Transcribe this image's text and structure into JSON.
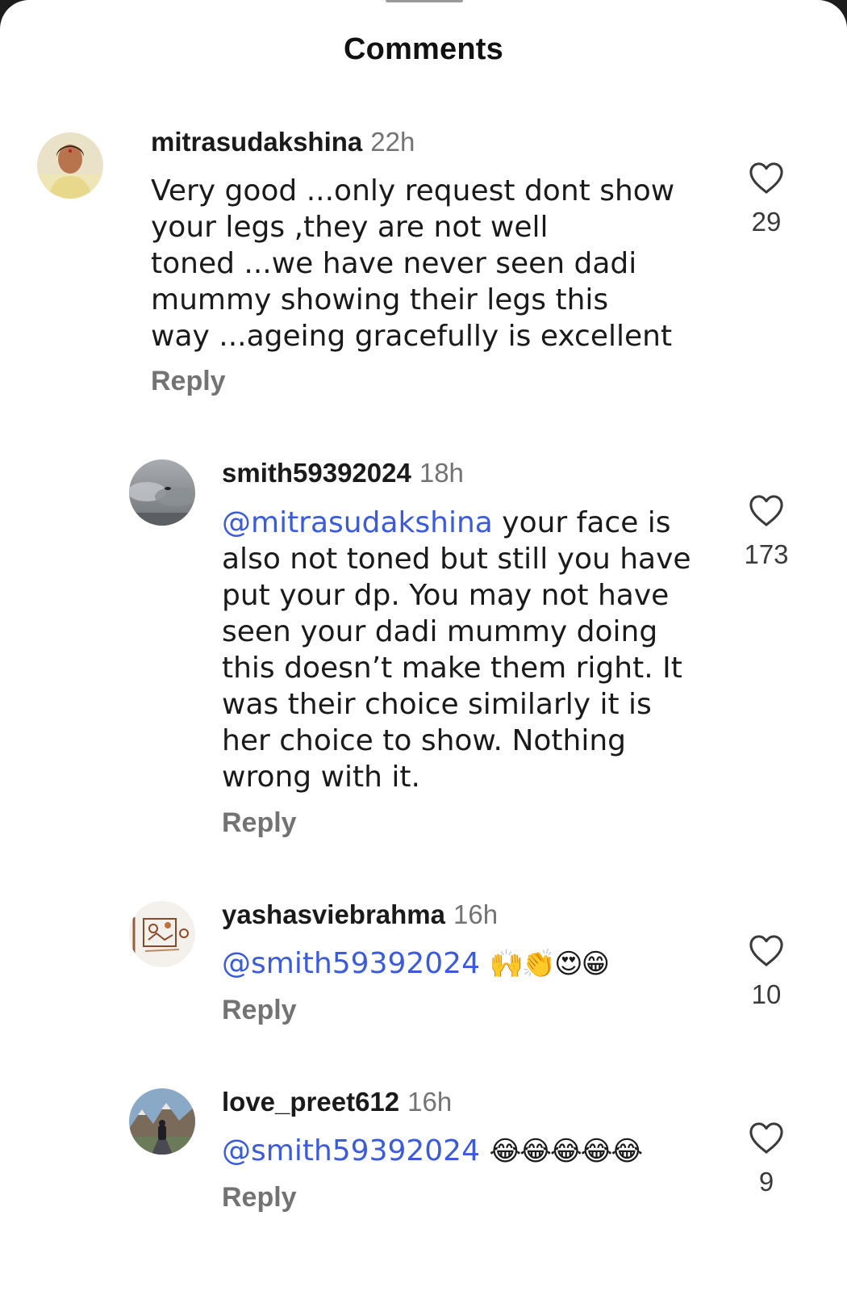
{
  "sheet": {
    "title": "Comments"
  },
  "comments": [
    {
      "username": "mitrasudakshina",
      "time": "22h",
      "text_lines": [
        "Very good ...only request dont show",
        "your legs ,they are not well",
        "toned ...we have never seen dadi",
        "mummy showing their legs this",
        "way ...ageing gracefully  is excellent"
      ],
      "reply_label": "Reply",
      "like_count": "29",
      "avatar_icon": "profile-photo-woman"
    },
    {
      "username": "smith59392024",
      "time": "18h",
      "mention": "@mitrasudakshina",
      "text_first_line_rest": " your face is",
      "text_lines": [
        "also not toned but still you have",
        "put your dp. You may not have",
        "seen your dadi mummy doing",
        "this doesn’t make them right. It",
        "was their choice similarly it is",
        "her choice to show. Nothing",
        "wrong with it."
      ],
      "reply_label": "Reply",
      "like_count": "173",
      "avatar_icon": "profile-photo-cloudy-sky"
    },
    {
      "username": "yashasviebrahma",
      "time": "16h",
      "mention": "@smith59392024",
      "emojis": "🙌👏😍😁",
      "reply_label": "Reply",
      "like_count": "10",
      "avatar_icon": "profile-photo-sketch"
    },
    {
      "username": "love_preet612",
      "time": "16h",
      "mention": "@smith59392024",
      "emojis": "😂😂😂😂😂",
      "reply_label": "Reply",
      "like_count": "9",
      "avatar_icon": "profile-photo-mountains"
    }
  ],
  "colors": {
    "mention": "#3b5bdb",
    "secondary_text": "#737373",
    "primary_text": "#1a1a1a"
  }
}
